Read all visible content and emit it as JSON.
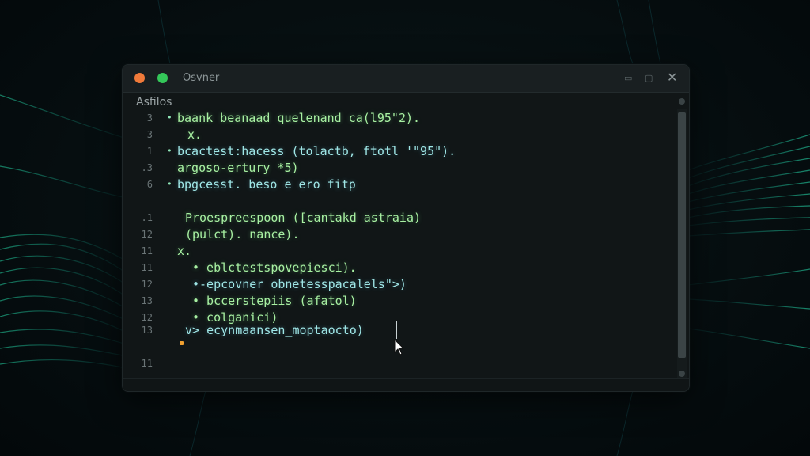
{
  "window": {
    "title": "Osvner",
    "controls": {
      "minimize_icon": "minimize-icon",
      "maximize_icon": "maximize-icon",
      "close": "✕"
    }
  },
  "editor": {
    "section_label": "Asfilos",
    "lines": [
      {
        "number": "3",
        "marker": "•",
        "text": "baank beanaad quelenand ca(l95\"2)."
      },
      {
        "number": "3",
        "marker": "",
        "text": "x."
      },
      {
        "number": "1",
        "marker": "•",
        "text": "bcactest:hacess (tolactb, ftotl '\"95\")."
      },
      {
        "number": ".3",
        "marker": "",
        "text": "argoso-ertury *5)"
      },
      {
        "number": "6",
        "marker": "•",
        "text": "bpgcesst. beso e ero fitp"
      },
      {
        "number": ".1",
        "marker": "",
        "text": "Proespreespoon ([cantakd astraia)"
      },
      {
        "number": "12",
        "marker": "",
        "text": "(pulct). nance)."
      },
      {
        "number": "11",
        "marker": "",
        "text": "x."
      },
      {
        "number": "11",
        "marker": "",
        "text": "• eblctestspovepiesci)."
      },
      {
        "number": "12",
        "marker": "",
        "text": "•-epcovner obnetesspacalels\">)"
      },
      {
        "number": "13",
        "marker": "",
        "text": "• bccerstepiis (afatol)"
      },
      {
        "number": "12",
        "marker": "",
        "text": "• colganici)"
      },
      {
        "number": "13",
        "marker": "",
        "text": "v> ecynmaansen_moptaocto)"
      },
      {
        "number": "11",
        "marker": "",
        "text": ""
      }
    ]
  },
  "colors": {
    "code_green": "#a8f0a2",
    "code_cyan": "#9fe6e6",
    "accent_orange": "#f07a3a",
    "accent_green": "#34c759"
  }
}
